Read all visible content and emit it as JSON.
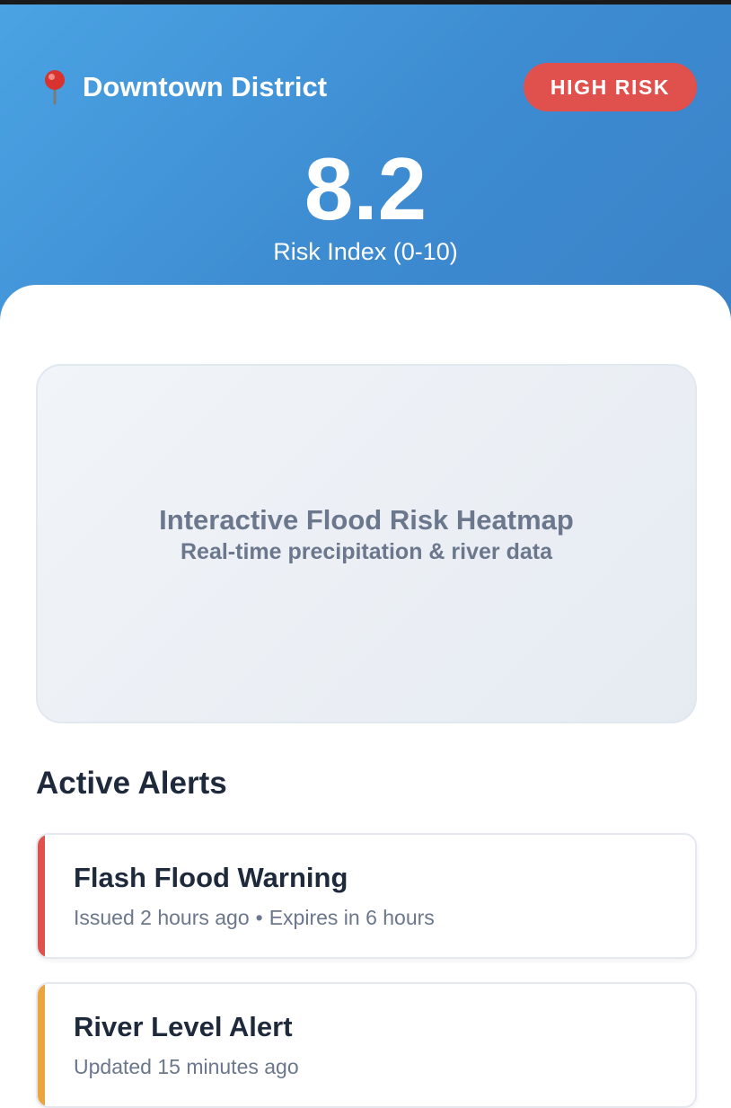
{
  "header": {
    "location": "Downtown District",
    "risk_badge": "HIGH RISK",
    "risk_value": "8.2",
    "risk_label": "Risk Index (0-10)"
  },
  "heatmap": {
    "title": "Interactive Flood Risk Heatmap",
    "subtitle": "Real-time precipitation & river data"
  },
  "alerts": {
    "section_title": "Active Alerts",
    "items": [
      {
        "title": "Flash Flood Warning",
        "issued": "Issued 2 hours ago",
        "separator": "•",
        "expires": "Expires in 6 hours",
        "severity_color": "#e0504d"
      },
      {
        "title": "River Level Alert",
        "issued": "Updated 15 minutes ago",
        "severity_color": "#eba43e"
      }
    ]
  },
  "colors": {
    "header_gradient_start": "#4aa3e3",
    "header_gradient_end": "#3a82c8",
    "high_risk": "#e0504d",
    "warning": "#eba43e"
  },
  "icons": {
    "location": "map-pin-icon"
  }
}
